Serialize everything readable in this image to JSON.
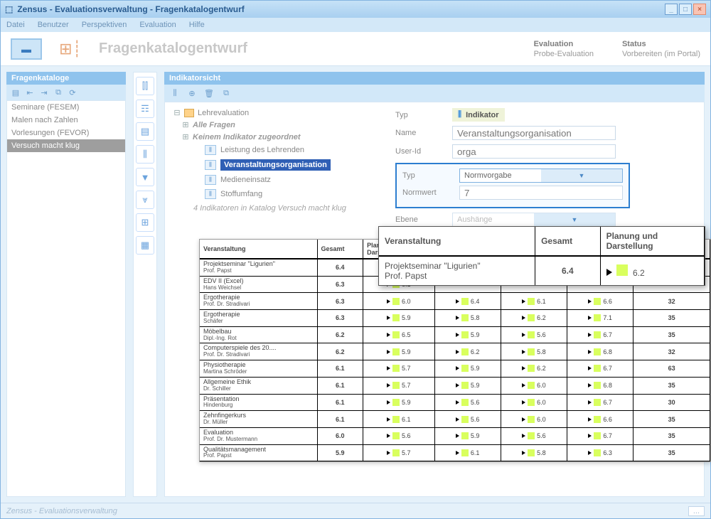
{
  "titlebar": {
    "title": "Zensus - Evaluationsverwaltung - Fragenkatalogentwurf"
  },
  "menubar": [
    "Datei",
    "Benutzer",
    "Perspektiven",
    "Evaluation",
    "Hilfe"
  ],
  "header": {
    "title": "Fragenkatalogentwurf",
    "meta": {
      "evaluation_lbl": "Evaluation",
      "evaluation_val": "Probe-Evaluation",
      "status_lbl": "Status",
      "status_val": "Vorbereiten (im Portal)"
    }
  },
  "left_panel": {
    "title": "Fragenkataloge",
    "items": [
      "Seminare (FESEM)",
      "Malen nach Zahlen",
      "Vorlesungen (FEVOR)",
      "Versuch macht klug"
    ],
    "selected_index": 3
  },
  "right_panel": {
    "title": "Indikatorsicht",
    "tree": {
      "root": "Lehrevaluation",
      "group1": "Alle Fragen",
      "group2": "Keinem Indikator zugeordnet",
      "leaves": [
        "Leistung des Lehrenden",
        "Veranstaltungsorganisation",
        "Medieneinsatz",
        "Stoffumfang"
      ],
      "selected_index": 1,
      "summary": "4 Indikatoren in Katalog Versuch macht klug"
    },
    "form": {
      "typ_lbl": "Typ",
      "typ_chip": "Indikator",
      "name_lbl": "Name",
      "name_val": "Veranstaltungsorganisation",
      "userid_lbl": "User-Id",
      "userid_val": "orga",
      "typ2_lbl": "Typ",
      "typ2_val": "Normvorgabe",
      "normwert_lbl": "Normwert",
      "normwert_val": "7",
      "ebene_lbl": "Ebene",
      "ebene_val": "Aushänge"
    }
  },
  "bigrow": {
    "hdr": [
      "Veranstaltung",
      "Gesamt",
      "Planung und Darstellung"
    ],
    "course_l1": "Projektseminar \"Ligurien\"",
    "course_l2": "Prof. Papst",
    "gesamt": "6.4",
    "pd": "6.2"
  },
  "table": {
    "headers": [
      "Veranstaltung",
      "Gesamt",
      "Planung und Darstellung",
      "",
      "",
      "",
      ""
    ],
    "rows": [
      {
        "c": "Projektseminar \"Ligurien\"",
        "p": "Prof. Papst",
        "g": "6.4",
        "v": [
          "6.2",
          "",
          "",
          "",
          ""
        ]
      },
      {
        "c": "EDV II (Excel)",
        "p": "Hans Weichsel",
        "g": "6.3",
        "v": [
          "6.1",
          "",
          "",
          "",
          ""
        ]
      },
      {
        "c": "Ergotherapie",
        "p": "Prof. Dr. Stradivari",
        "g": "6.3",
        "v": [
          "6.0",
          "6.4",
          "6.1",
          "6.6",
          "32"
        ]
      },
      {
        "c": "Ergotherapie",
        "p": "Schäfer",
        "g": "6.3",
        "v": [
          "5.9",
          "5.8",
          "6.2",
          "7.1",
          "35"
        ]
      },
      {
        "c": "Möbelbau",
        "p": "Dipl.-Ing. Rot",
        "g": "6.2",
        "v": [
          "6.5",
          "5.9",
          "5.6",
          "6.7",
          "35"
        ]
      },
      {
        "c": "Computerspiele des 20....",
        "p": "Prof. Dr. Stradivari",
        "g": "6.2",
        "v": [
          "5.9",
          "6.2",
          "5.8",
          "6.8",
          "32"
        ]
      },
      {
        "c": "Physiotherapie",
        "p": "Martina Schröder",
        "g": "6.1",
        "v": [
          "5.7",
          "5.9",
          "6.2",
          "6.7",
          "63"
        ]
      },
      {
        "c": "Allgemeine Ethik",
        "p": "Dr. Schiller",
        "g": "6.1",
        "v": [
          "5.7",
          "5.9",
          "6.0",
          "6.8",
          "35"
        ]
      },
      {
        "c": "Präsentation",
        "p": "Hindenburg",
        "g": "6.1",
        "v": [
          "5.9",
          "5.6",
          "6.0",
          "6.7",
          "30"
        ]
      },
      {
        "c": "Zehnfingerkurs",
        "p": "Dr. Müller",
        "g": "6.1",
        "v": [
          "6.1",
          "5.6",
          "6.0",
          "6.6",
          "35"
        ]
      },
      {
        "c": "Evaluation",
        "p": "Prof. Dr. Mustermann",
        "g": "6.0",
        "v": [
          "5.6",
          "5.9",
          "5.6",
          "6.7",
          "35"
        ]
      },
      {
        "c": "Qualitätsmanagement",
        "p": "Prof. Papst",
        "g": "5.9",
        "v": [
          "5.7",
          "6.1",
          "5.8",
          "6.3",
          "35"
        ]
      }
    ]
  },
  "statusbar": {
    "text": "Zensus - Evaluationsverwaltung",
    "dots": "..."
  }
}
